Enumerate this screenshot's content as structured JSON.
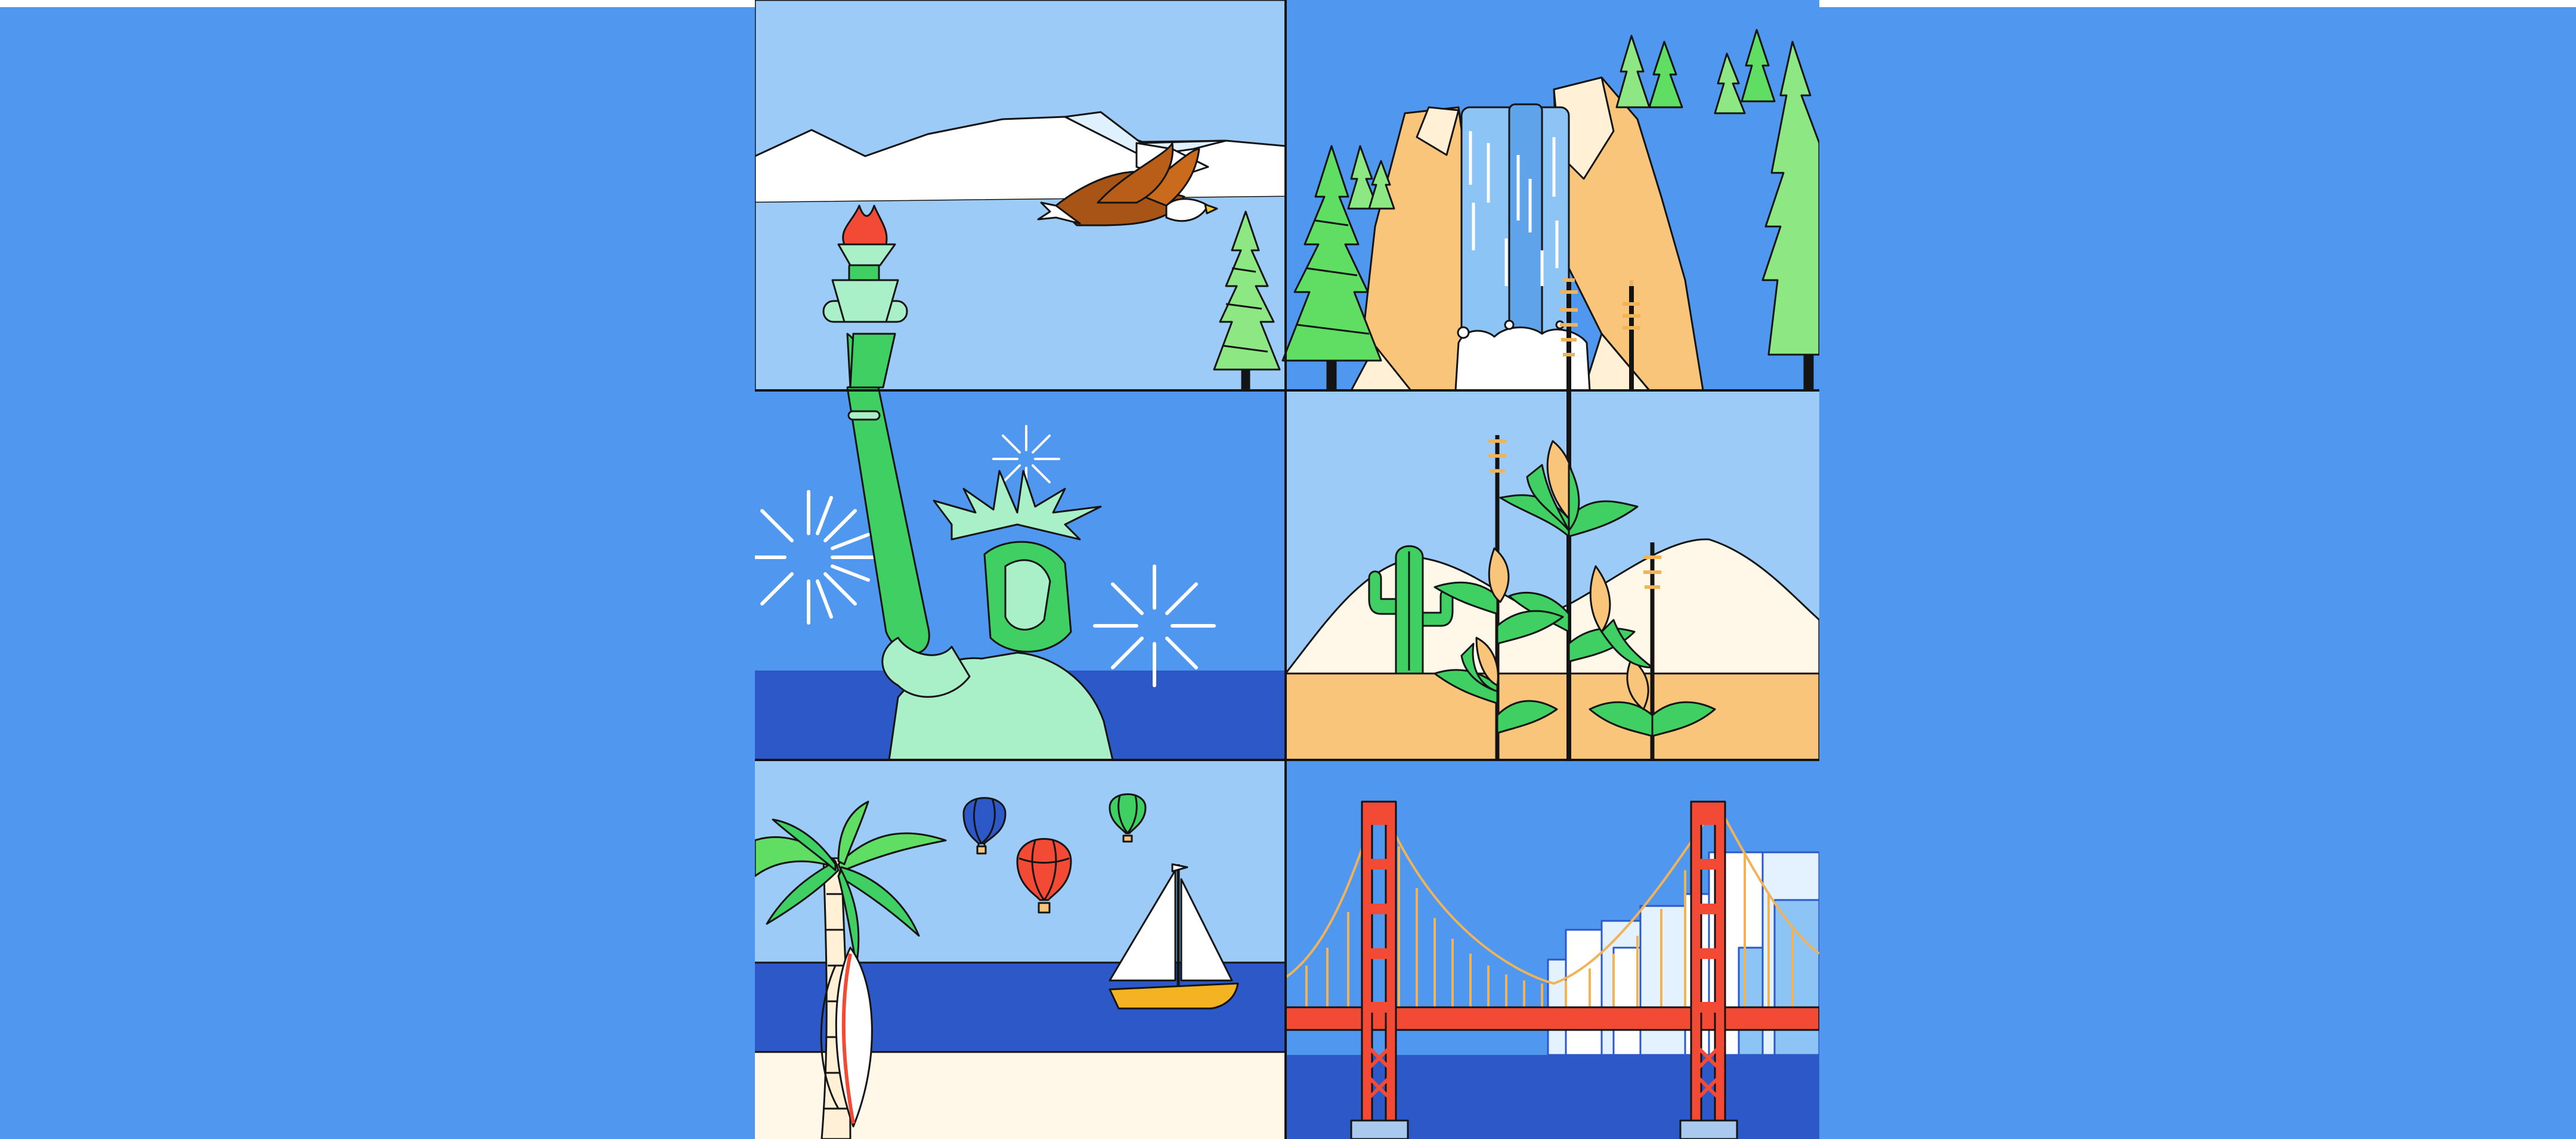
{
  "colors": {
    "background_blue": "#5097ef",
    "sky_light": "#9ccbf7",
    "sea_dark": "#2d59c8",
    "sand": "#fff8e8",
    "desert": "#f8c57a",
    "liberty_green": "#3fcf62",
    "liberty_light": "#a9efc7",
    "bridge_red": "#f24a35",
    "outline": "#141414"
  },
  "panels": [
    {
      "name": "mountains-eagle-panel",
      "icons": [
        "mountain-icon",
        "eagle-icon",
        "pine-tree-icon"
      ]
    },
    {
      "name": "waterfall-forest-panel",
      "icons": [
        "waterfall-icon",
        "cliff-icon",
        "pine-tree-icon"
      ]
    },
    {
      "name": "statue-of-liberty-panel",
      "icons": [
        "statue-of-liberty-icon",
        "torch-icon",
        "fireworks-icon"
      ]
    },
    {
      "name": "desert-cornfield-panel",
      "icons": [
        "cactus-icon",
        "corn-stalk-icon",
        "hill-icon"
      ]
    },
    {
      "name": "beach-panel",
      "icons": [
        "palm-tree-icon",
        "surfboard-icon",
        "hot-air-balloon-icon",
        "sailboat-icon"
      ]
    },
    {
      "name": "golden-gate-panel",
      "icons": [
        "suspension-bridge-icon",
        "city-skyline-icon"
      ]
    }
  ]
}
